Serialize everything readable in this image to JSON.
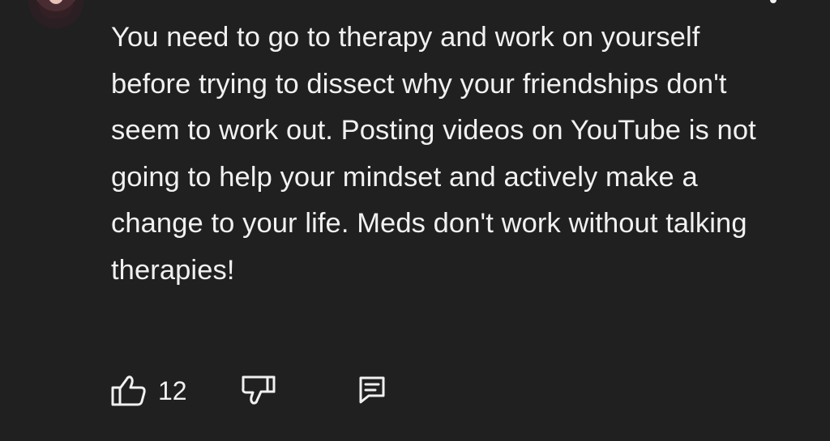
{
  "comment": {
    "author": "",
    "text": "You need to go to therapy and work on yourself before trying to dissect why your friendships don't seem to work out. Posting videos on YouTube is not going to help your mindset and actively make a change to your life. Meds don't work without talking therapies!",
    "likes": "12"
  },
  "icons": {
    "like": "thumb-up-icon",
    "dislike": "thumb-down-icon",
    "reply": "comment-reply-icon",
    "menu": "more-vert-icon"
  },
  "colors": {
    "background": "#202020",
    "text": "#f1f1f1"
  }
}
